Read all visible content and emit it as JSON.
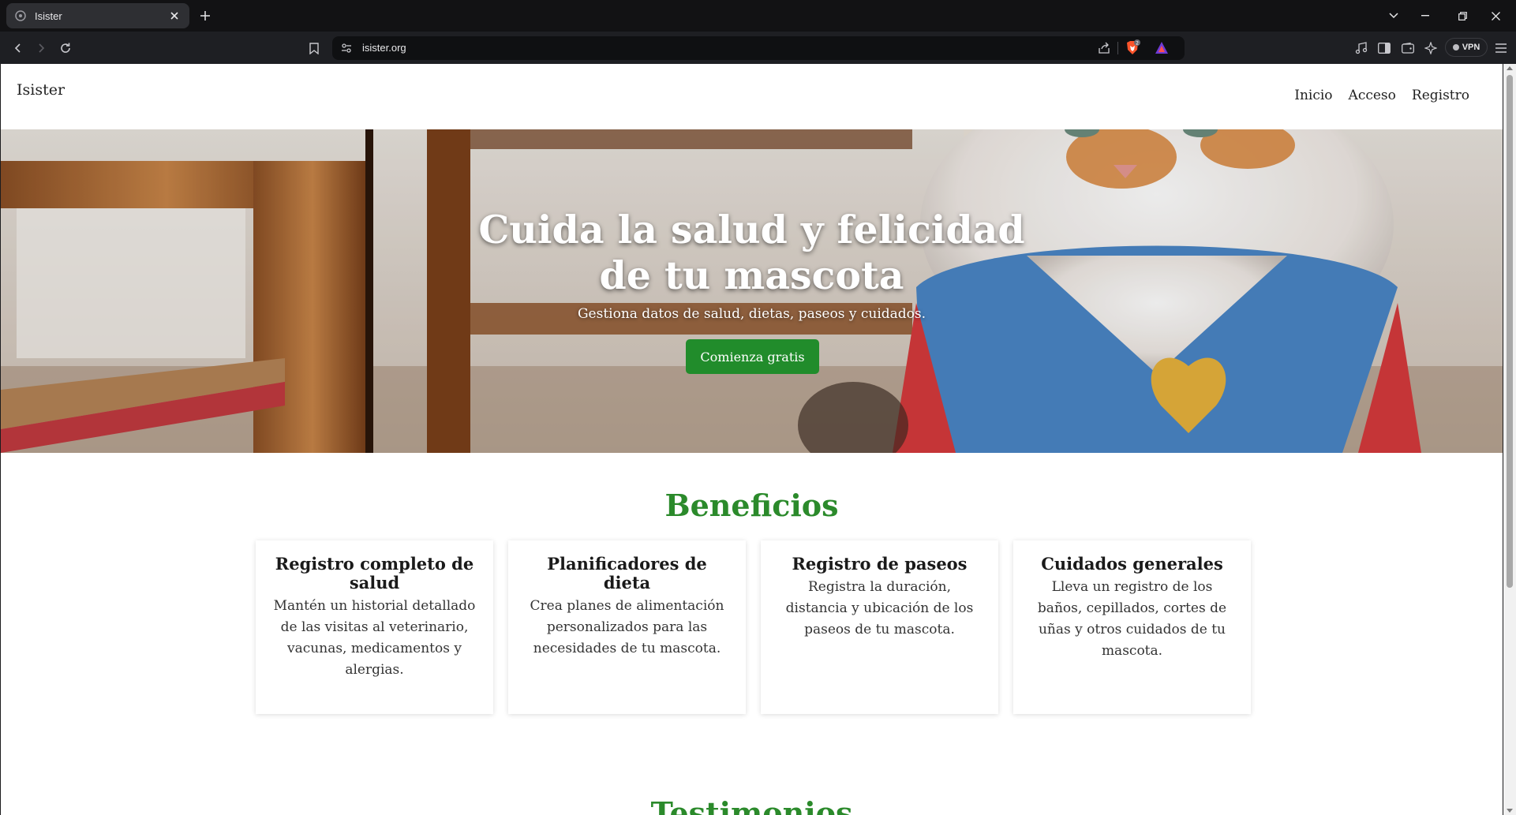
{
  "browser": {
    "tab_title": "Isister",
    "url": "isister.org",
    "brave_badge": "2",
    "vpn_label": "VPN"
  },
  "site": {
    "brand": "Isister",
    "nav": [
      "Inicio",
      "Acceso",
      "Registro"
    ]
  },
  "hero": {
    "title_line1": "Cuida la salud y felicidad",
    "title_line2": "de tu mascota",
    "subtitle": "Gestiona datos de salud, dietas, paseos y cuidados.",
    "cta": "Comienza gratis"
  },
  "benefits": {
    "title": "Beneficios",
    "cards": [
      {
        "title": "Registro completo de salud",
        "text": "Mantén un historial detallado de las visitas al veterinario, vacunas, medicamentos y alergias."
      },
      {
        "title": "Planificadores de dieta",
        "text": "Crea planes de alimentación personalizados para las necesidades de tu mascota."
      },
      {
        "title": "Registro de paseos",
        "text": "Registra la duración, distancia y ubicación de los paseos de tu mascota."
      },
      {
        "title": "Cuidados generales",
        "text": "Lleva un registro de los baños, cepillados, cortes de uñas y otros cuidados de tu mascota."
      }
    ]
  },
  "next_section": {
    "title": "Testimonios"
  },
  "colors": {
    "accent_green": "#218c2b",
    "heading_green": "#2b8a2b"
  }
}
